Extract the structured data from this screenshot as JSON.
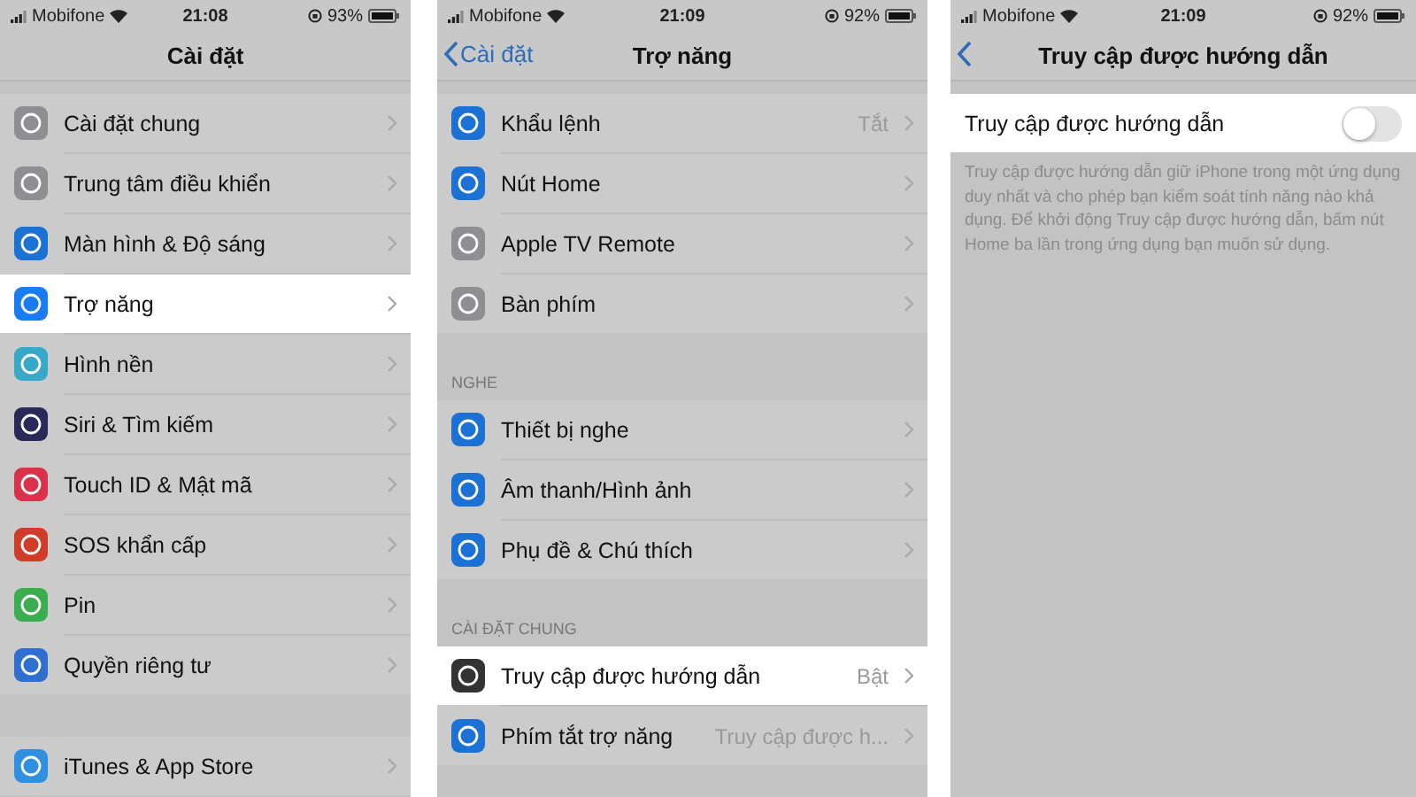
{
  "panels": [
    {
      "status": {
        "carrier": "Mobifone",
        "time": "21:08",
        "battery": "93%"
      },
      "nav": {
        "has_back": false,
        "title": "Cài đặt"
      },
      "groups": [
        {
          "rows": [
            {
              "kind": "link",
              "label": "Cài đặt chung",
              "color": "#8e8e93",
              "selected": false
            },
            {
              "kind": "link",
              "label": "Trung tâm điều khiển",
              "color": "#8e8e93",
              "selected": false
            },
            {
              "kind": "link",
              "label": "Màn hình & Độ sáng",
              "color": "#1c72d4",
              "selected": false
            },
            {
              "kind": "link",
              "label": "Trợ năng",
              "color": "#1a7cf5",
              "selected": true
            },
            {
              "kind": "link",
              "label": "Hình nền",
              "color": "#38a8c8",
              "selected": false
            },
            {
              "kind": "link",
              "label": "Siri & Tìm kiếm",
              "color": "#2a2a5a",
              "selected": false
            },
            {
              "kind": "link",
              "label": "Touch ID & Mật mã",
              "color": "#d8334a",
              "selected": false
            },
            {
              "kind": "link",
              "label": "SOS khẩn cấp",
              "color": "#d03b2a",
              "selected": false
            },
            {
              "kind": "link",
              "label": "Pin",
              "color": "#3aae4e",
              "selected": false
            },
            {
              "kind": "link",
              "label": "Quyền riêng tư",
              "color": "#2f6fcf",
              "selected": false
            }
          ]
        },
        {
          "rows": [
            {
              "kind": "link",
              "label": "iTunes & App Store",
              "color": "#2f8fe0",
              "selected": false
            }
          ]
        }
      ]
    },
    {
      "status": {
        "carrier": "Mobifone",
        "time": "21:09",
        "battery": "92%"
      },
      "nav": {
        "has_back": true,
        "back": "Cài đặt",
        "title": "Trợ năng"
      },
      "groups": [
        {
          "rows": [
            {
              "kind": "link",
              "label": "Khẩu lệnh",
              "value": "Tắt",
              "color": "#1c72d4",
              "selected": false
            },
            {
              "kind": "link",
              "label": "Nút Home",
              "color": "#1c72d4",
              "selected": false
            },
            {
              "kind": "link",
              "label": "Apple TV Remote",
              "color": "#8e8e93",
              "selected": false
            },
            {
              "kind": "link",
              "label": "Bàn phím",
              "color": "#8e8e93",
              "selected": false
            }
          ]
        },
        {
          "header": "NGHE",
          "rows": [
            {
              "kind": "link",
              "label": "Thiết bị nghe",
              "color": "#1c72d4",
              "selected": false
            },
            {
              "kind": "link",
              "label": "Âm thanh/Hình ảnh",
              "color": "#1c72d4",
              "selected": false
            },
            {
              "kind": "link",
              "label": "Phụ đề & Chú thích",
              "color": "#1c72d4",
              "selected": false
            }
          ]
        },
        {
          "header": "CÀI ĐẶT CHUNG",
          "rows": [
            {
              "kind": "link",
              "label": "Truy cập được hướng dẫn",
              "value": "Bật",
              "color": "#333333",
              "selected": true
            },
            {
              "kind": "link",
              "label": "Phím tắt trợ năng",
              "value": "Truy cập được h...",
              "color": "#1c72d4",
              "selected": false
            }
          ]
        }
      ]
    },
    {
      "status": {
        "carrier": "Mobifone",
        "time": "21:09",
        "battery": "92%"
      },
      "nav": {
        "has_back": true,
        "title": "Truy cập được hướng dẫn"
      },
      "groups": [
        {
          "footer": "Truy cập được hướng dẫn giữ iPhone trong một ứng dụng duy nhất và cho phép bạn kiểm soát tính năng nào khả dụng. Để khởi động Truy cập được hướng dẫn, bấm nút Home ba lần trong ứng dụng bạn muốn sử dụng.",
          "rows": [
            {
              "kind": "toggle",
              "label": "Truy cập được hướng dẫn",
              "on": false,
              "selected": true
            }
          ]
        }
      ]
    }
  ]
}
